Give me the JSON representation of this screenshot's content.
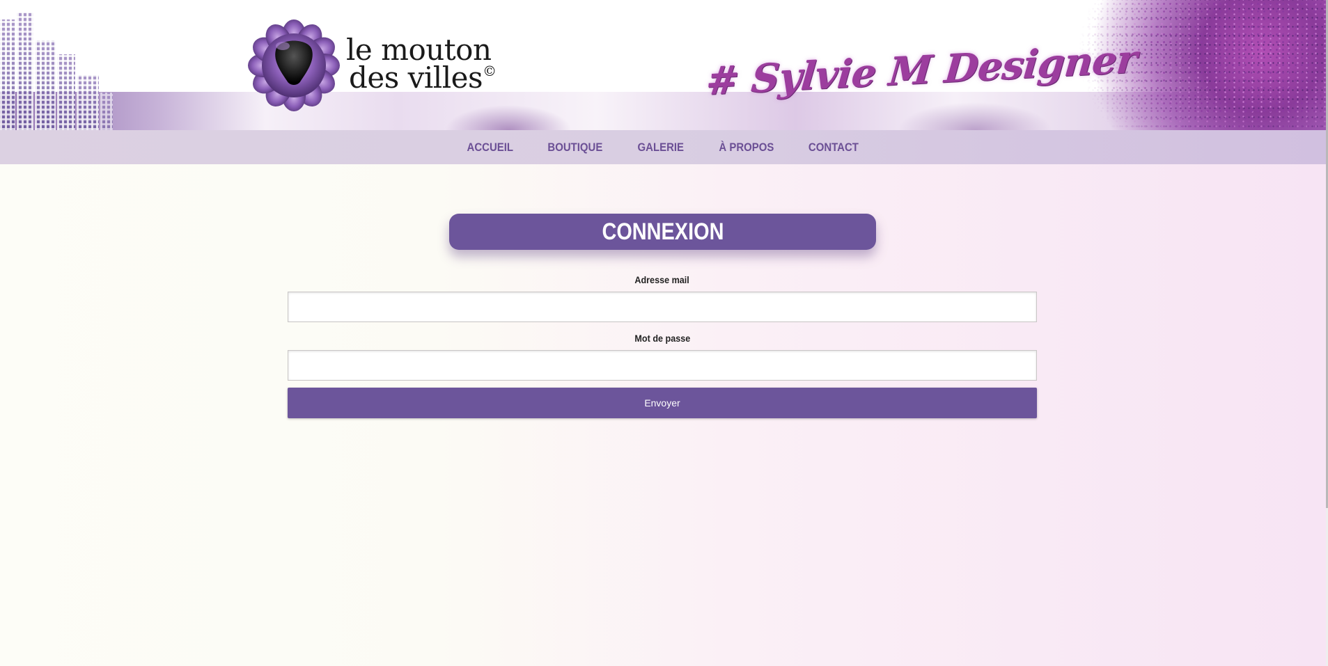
{
  "header": {
    "logo_line1": "le mouton",
    "logo_line2": "des villes",
    "logo_copyright": "©",
    "tagline": "# Sylvie M Designer"
  },
  "nav": {
    "items": [
      {
        "label": "ACCUEIL"
      },
      {
        "label": "BOUTIQUE"
      },
      {
        "label": "GALERIE"
      },
      {
        "label": "À PROPOS"
      },
      {
        "label": "CONTACT"
      }
    ]
  },
  "login": {
    "title": "CONNEXION",
    "email_label": "Adresse mail",
    "email_value": "",
    "password_label": "Mot de passe",
    "password_value": "",
    "submit_label": "Envoyer"
  },
  "colors": {
    "accent": "#6c559b",
    "nav_text": "#6b4f95",
    "nav_bg": "#d9cee2"
  }
}
